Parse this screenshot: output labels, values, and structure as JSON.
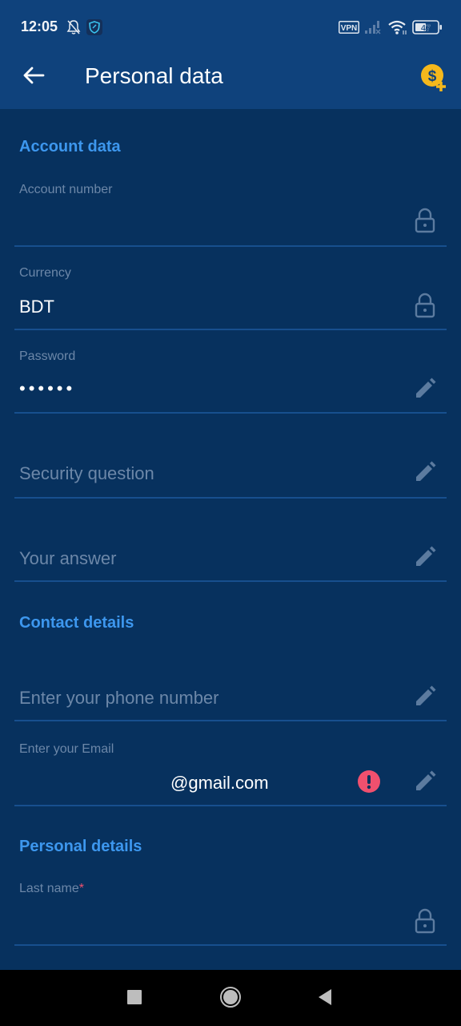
{
  "status_bar": {
    "time": "12:05",
    "icons": [
      "notifications-off-icon",
      "shield-app-icon"
    ],
    "vpn_label": "VPN",
    "battery_level": "47",
    "right_icons": [
      "vpn-icon",
      "signal-icon",
      "wifi-icon",
      "battery-icon"
    ]
  },
  "header": {
    "title": "Personal data",
    "back_icon": "arrow-left-icon",
    "action_icon": "add-money-icon"
  },
  "sections": {
    "account": {
      "title": "Account data",
      "fields": {
        "account_number": {
          "label": "Account number",
          "value": "",
          "icon": "lock-icon"
        },
        "currency": {
          "label": "Currency",
          "value": "BDT",
          "icon": "lock-icon"
        },
        "password": {
          "label": "Password",
          "value": "••••••",
          "icon": "pencil-icon"
        },
        "security_question": {
          "placeholder": "Security question",
          "icon": "pencil-icon"
        },
        "your_answer": {
          "placeholder": "Your answer",
          "icon": "pencil-icon"
        }
      }
    },
    "contact": {
      "title": "Contact details",
      "fields": {
        "phone": {
          "placeholder": "Enter your phone number",
          "icon": "pencil-icon"
        },
        "email": {
          "label": "Enter your Email",
          "value": "@gmail.com",
          "warning_icon": "error-icon",
          "icon": "pencil-icon"
        }
      }
    },
    "personal": {
      "title": "Personal details",
      "fields": {
        "last_name": {
          "label": "Last name",
          "required_mark": "*",
          "value": "",
          "icon": "lock-icon"
        }
      }
    }
  },
  "colors": {
    "background": "#07315e",
    "appbar": "#0f427c",
    "accent": "#3d97ee",
    "label": "#6c87a8",
    "divider": "#174f8e",
    "error": "#f0506e",
    "coin": "#f5b81c"
  },
  "nav_bar": {
    "buttons": [
      "recents-button",
      "home-button",
      "back-button"
    ]
  }
}
